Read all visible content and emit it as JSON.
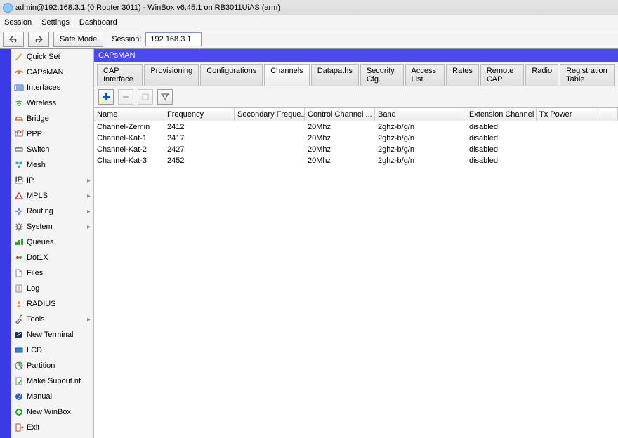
{
  "title": "admin@192.168.3.1 (0 Router 3011) - WinBox v6.45.1 on RB3011UiAS (arm)",
  "menu": {
    "session": "Session",
    "settings": "Settings",
    "dashboard": "Dashboard"
  },
  "toolbar": {
    "safe_mode": "Safe Mode",
    "session_label": "Session:",
    "session_value": "192.168.3.1"
  },
  "sidebar": [
    {
      "icon": "wand",
      "label": "Quick Set"
    },
    {
      "icon": "cap",
      "label": "CAPsMAN"
    },
    {
      "icon": "ifaces",
      "label": "Interfaces"
    },
    {
      "icon": "wifi",
      "label": "Wireless"
    },
    {
      "icon": "bridge",
      "label": "Bridge"
    },
    {
      "icon": "ppp",
      "label": "PPP"
    },
    {
      "icon": "switch",
      "label": "Switch"
    },
    {
      "icon": "mesh",
      "label": "Mesh"
    },
    {
      "icon": "ip",
      "label": "IP",
      "sub": true
    },
    {
      "icon": "mpls",
      "label": "MPLS",
      "sub": true
    },
    {
      "icon": "routing",
      "label": "Routing",
      "sub": true
    },
    {
      "icon": "gear",
      "label": "System",
      "sub": true
    },
    {
      "icon": "queues",
      "label": "Queues"
    },
    {
      "icon": "dot1x",
      "label": "Dot1X"
    },
    {
      "icon": "files",
      "label": "Files"
    },
    {
      "icon": "log",
      "label": "Log"
    },
    {
      "icon": "radius",
      "label": "RADIUS"
    },
    {
      "icon": "tools",
      "label": "Tools",
      "sub": true
    },
    {
      "icon": "term",
      "label": "New Terminal"
    },
    {
      "icon": "lcd",
      "label": "LCD"
    },
    {
      "icon": "partition",
      "label": "Partition"
    },
    {
      "icon": "supout",
      "label": "Make Supout.rif"
    },
    {
      "icon": "manual",
      "label": "Manual"
    },
    {
      "icon": "newwb",
      "label": "New WinBox"
    },
    {
      "icon": "exit",
      "label": "Exit"
    }
  ],
  "panel": {
    "title": "CAPsMAN"
  },
  "tabs": [
    "CAP Interface",
    "Provisioning",
    "Configurations",
    "Channels",
    "Datapaths",
    "Security Cfg.",
    "Access List",
    "Rates",
    "Remote CAP",
    "Radio",
    "Registration Table"
  ],
  "active_tab": 3,
  "grid": {
    "columns": [
      "Name",
      "Frequency",
      "Secondary Freque...",
      "Control Channel ...",
      "Band",
      "Extension Channel",
      "Tx Power"
    ],
    "rows": [
      {
        "name": "Channel-Zemin",
        "freq": "2412",
        "sec": "",
        "ctrl": "20Mhz",
        "band": "2ghz-b/g/n",
        "ext": "disabled",
        "tx": ""
      },
      {
        "name": "Channel-Kat-1",
        "freq": "2417",
        "sec": "",
        "ctrl": "20Mhz",
        "band": "2ghz-b/g/n",
        "ext": "disabled",
        "tx": ""
      },
      {
        "name": "Channel-Kat-2",
        "freq": "2427",
        "sec": "",
        "ctrl": "20Mhz",
        "band": "2ghz-b/g/n",
        "ext": "disabled",
        "tx": ""
      },
      {
        "name": "Channel-Kat-3",
        "freq": "2452",
        "sec": "",
        "ctrl": "20Mhz",
        "band": "2ghz-b/g/n",
        "ext": "disabled",
        "tx": ""
      }
    ]
  }
}
